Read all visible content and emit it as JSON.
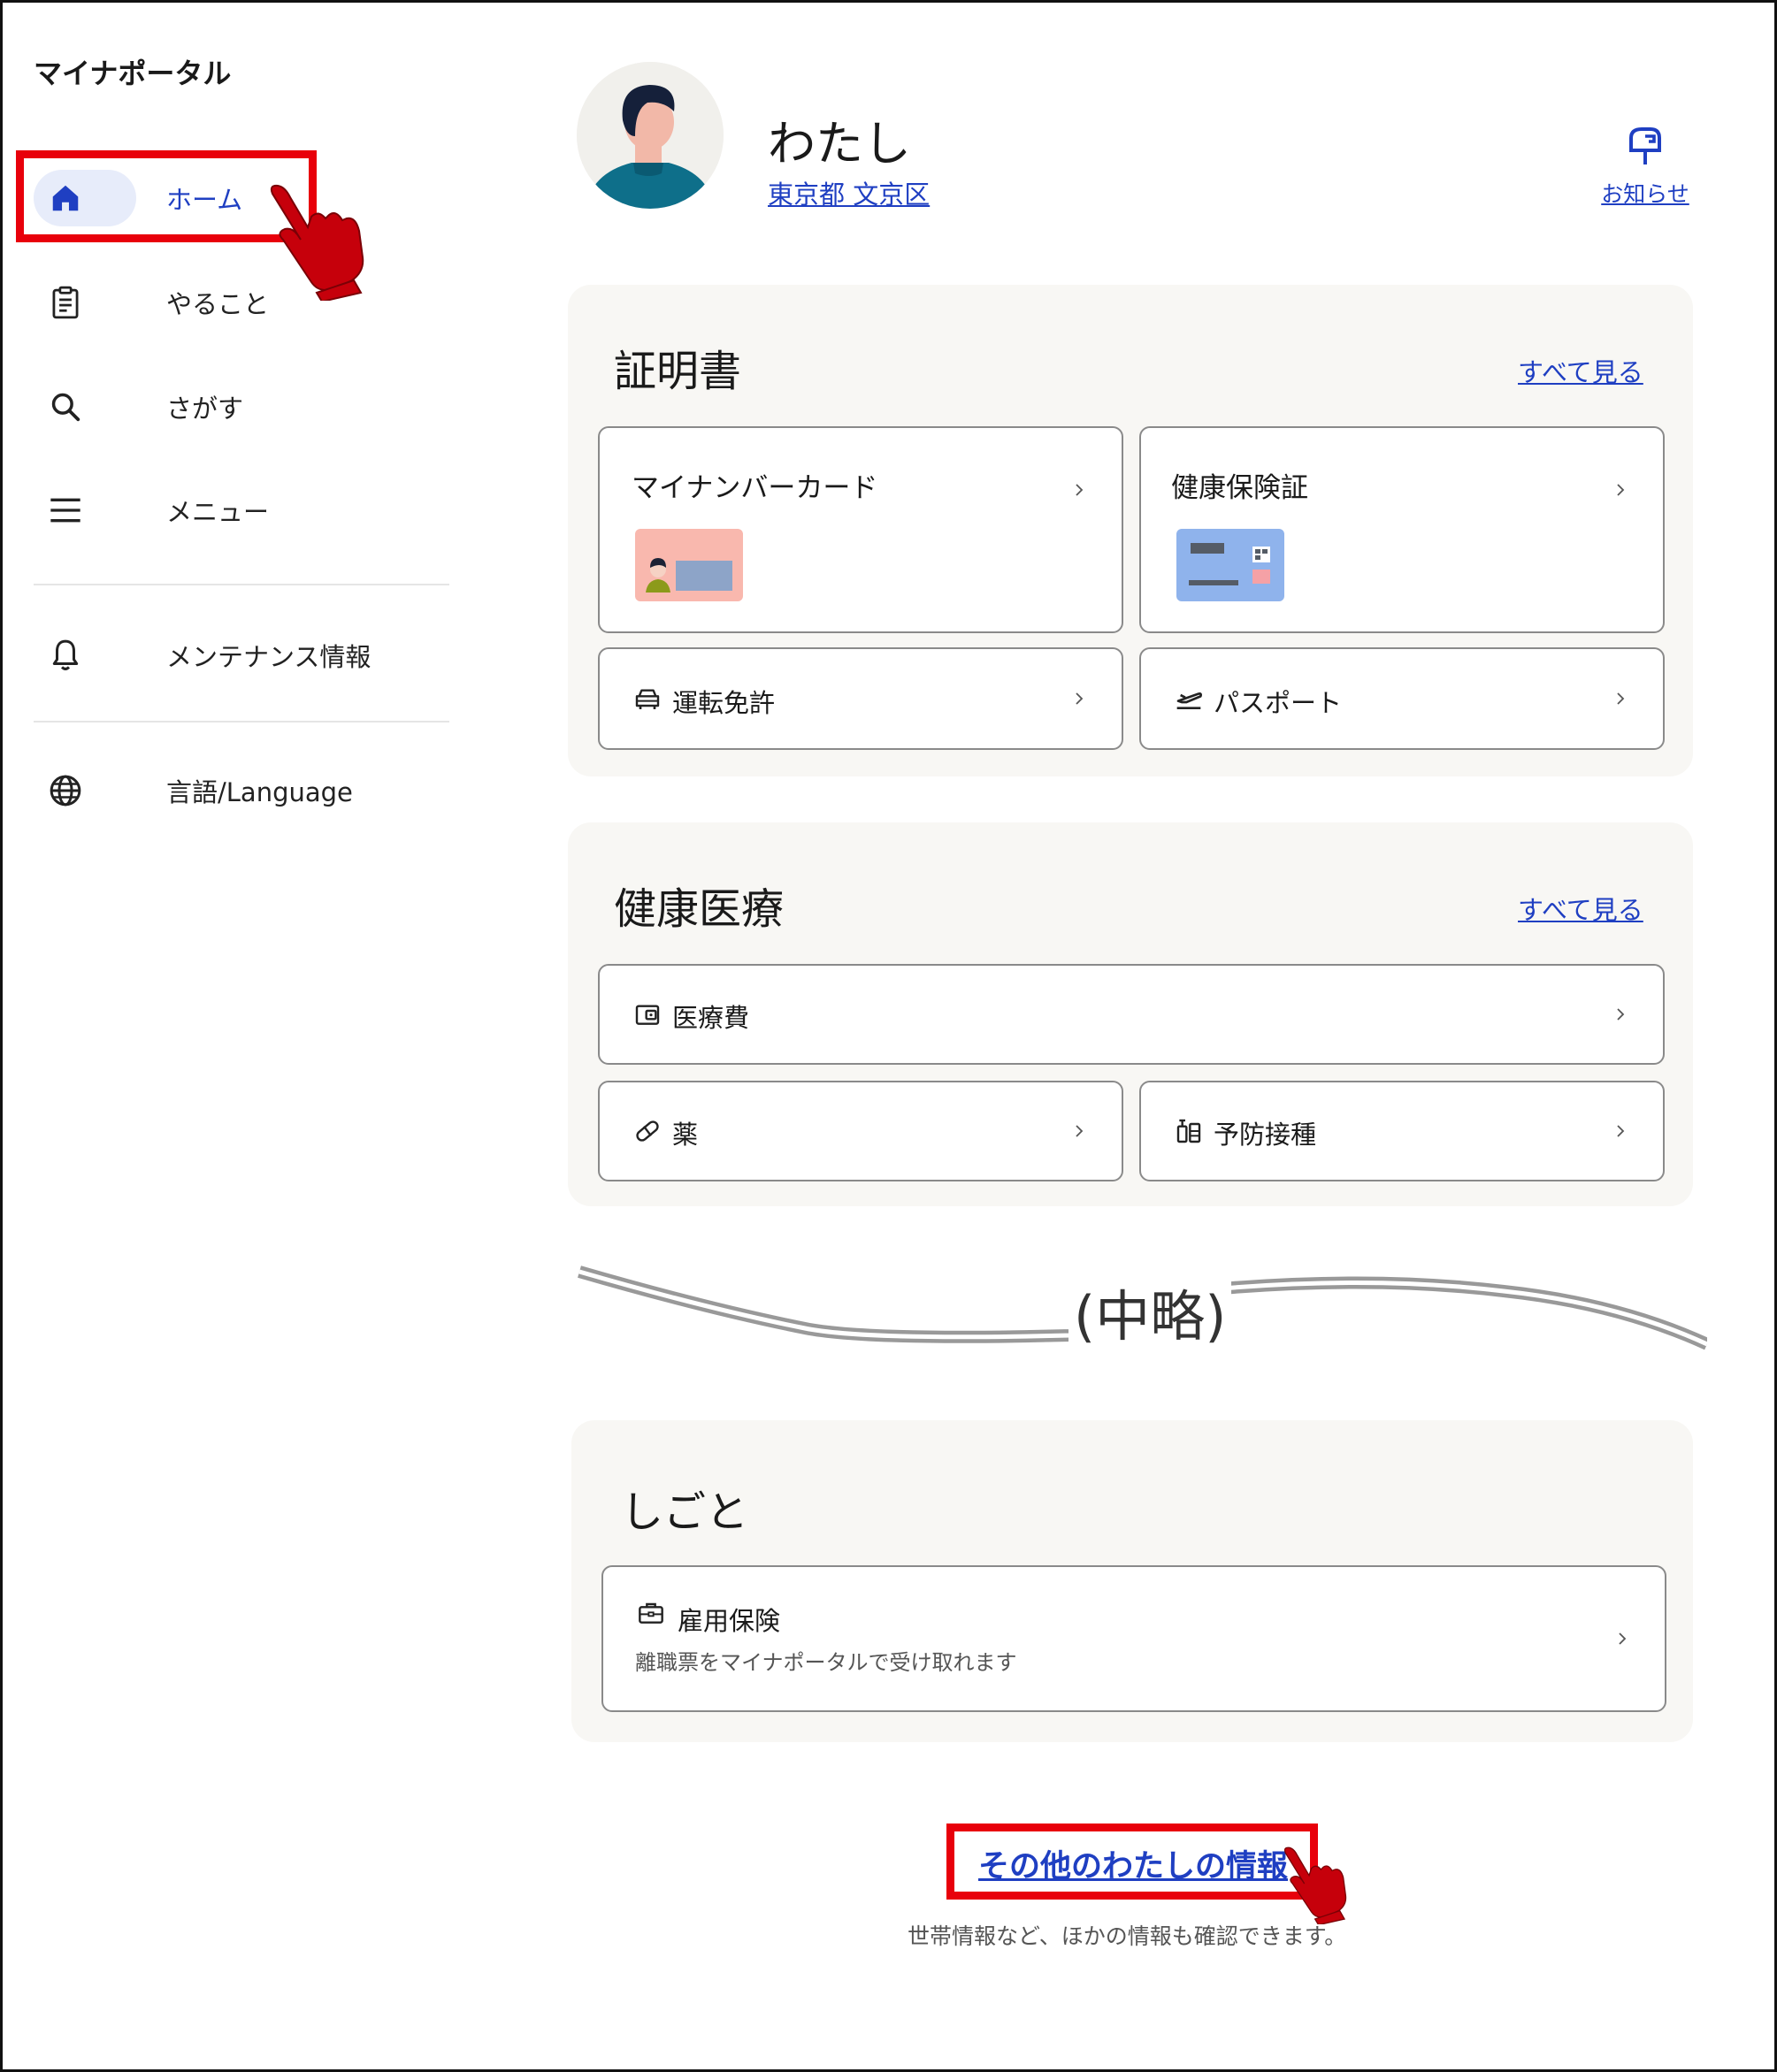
{
  "app": {
    "title": "マイナポータル"
  },
  "sidebar": {
    "items": [
      {
        "label": "ホーム",
        "icon": "home-icon",
        "active": true
      },
      {
        "label": "やること",
        "icon": "clipboard-icon"
      },
      {
        "label": "さがす",
        "icon": "search-icon"
      },
      {
        "label": "メニュー",
        "icon": "menu-icon"
      },
      {
        "label": "メンテナンス情報",
        "icon": "bell-icon"
      },
      {
        "label": "言語/Language",
        "icon": "globe-icon"
      }
    ]
  },
  "profile": {
    "name": "わたし",
    "location": "東京都 文京区"
  },
  "notice": {
    "label": "お知らせ",
    "icon": "mailbox-icon"
  },
  "certificates": {
    "title": "証明書",
    "see_all": "すべて見る",
    "cards": {
      "mynumber": "マイナンバーカード",
      "insurance": "健康保険証",
      "license": "運転免許",
      "passport": "パスポート"
    }
  },
  "health": {
    "title": "健康医療",
    "see_all": "すべて見る",
    "cards": {
      "medical_cost": "医療費",
      "medicine": "薬",
      "vaccination": "予防接種"
    }
  },
  "omission": {
    "label": "(中略)"
  },
  "work": {
    "title": "しごと",
    "cards": {
      "employment": "雇用保険",
      "employment_desc": "離職票をマイナポータルで受け取れます"
    }
  },
  "other": {
    "link": "その他のわたしの情報",
    "desc": "世帯情報など、ほかの情報も確認できます。"
  },
  "colors": {
    "accent": "#1f3fc2",
    "highlight": "#e8000b",
    "panel": "#f8f7f4"
  }
}
